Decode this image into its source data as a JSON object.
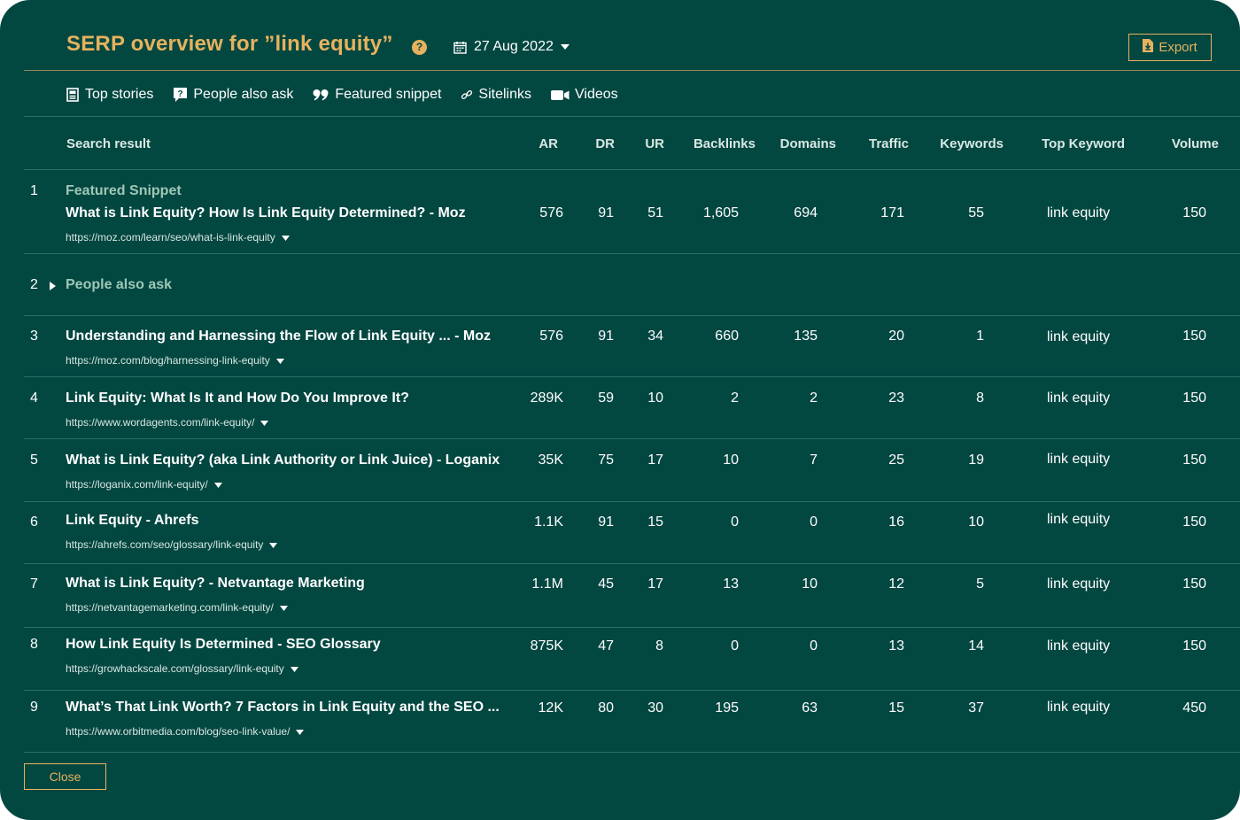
{
  "header": {
    "title": "SERP overview for ”link equity”",
    "help_icon": "?",
    "date": "27 Aug 2022",
    "export_label": "Export"
  },
  "features": [
    {
      "icon": "newspaper-icon",
      "label": "Top stories"
    },
    {
      "icon": "question-bubble-icon",
      "label": "People also ask"
    },
    {
      "icon": "quote-icon",
      "label": "Featured snippet"
    },
    {
      "icon": "link-icon",
      "label": "Sitelinks"
    },
    {
      "icon": "video-camera-icon",
      "label": "Videos"
    }
  ],
  "columns": {
    "search_result": "Search result",
    "ar": "AR",
    "dr": "DR",
    "ur": "UR",
    "backlinks": "Backlinks",
    "domains": "Domains",
    "traffic": "Traffic",
    "keywords": "Keywords",
    "top_keyword": "Top Keyword",
    "volume": "Volume"
  },
  "rows": [
    {
      "num": "1",
      "feature_label": "Featured Snippet",
      "title": "What is Link Equity? How Is Link Equity Determined? - Moz",
      "url": "https://moz.com/learn/seo/what-is-link-equity",
      "ar": "576",
      "dr": "91",
      "ur": "51",
      "backlinks": "1,605",
      "domains": "694",
      "traffic": "171",
      "keywords": "55",
      "top_keyword": "link equity",
      "volume": "150"
    },
    {
      "num": "2",
      "paa_label": "People also ask"
    },
    {
      "num": "3",
      "title": "Understanding and Harnessing the Flow of Link Equity ... - Moz",
      "url": "https://moz.com/blog/harnessing-link-equity",
      "ar": "576",
      "dr": "91",
      "ur": "34",
      "backlinks": "660",
      "domains": "135",
      "traffic": "20",
      "keywords": "1",
      "top_keyword": "link equity",
      "volume": "150"
    },
    {
      "num": "4",
      "title": "Link Equity: What Is It and How Do You Improve It?",
      "url": "https://www.wordagents.com/link-equity/",
      "ar": "289K",
      "dr": "59",
      "ur": "10",
      "backlinks": "2",
      "domains": "2",
      "traffic": "23",
      "keywords": "8",
      "top_keyword": "link equity",
      "volume": "150"
    },
    {
      "num": "5",
      "title": "What is Link Equity? (aka Link Authority or Link Juice) - Loganix",
      "url": "https://loganix.com/link-equity/",
      "ar": "35K",
      "dr": "75",
      "ur": "17",
      "backlinks": "10",
      "domains": "7",
      "traffic": "25",
      "keywords": "19",
      "top_keyword": "link equity",
      "volume": "150"
    },
    {
      "num": "6",
      "title": "Link Equity - Ahrefs",
      "url": "https://ahrefs.com/seo/glossary/link-equity",
      "ar": "1.1K",
      "dr": "91",
      "ur": "15",
      "backlinks": "0",
      "domains": "0",
      "traffic": "16",
      "keywords": "10",
      "top_keyword": "link equity",
      "volume": "150"
    },
    {
      "num": "7",
      "title": "What is Link Equity? - Netvantage Marketing",
      "url": "https://netvantagemarketing.com/link-equity/",
      "ar": "1.1M",
      "dr": "45",
      "ur": "17",
      "backlinks": "13",
      "domains": "10",
      "traffic": "12",
      "keywords": "5",
      "top_keyword": "link equity",
      "volume": "150"
    },
    {
      "num": "8",
      "title": "How Link Equity Is Determined - SEO Glossary",
      "url": "https://growhackscale.com/glossary/link-equity",
      "ar": "875K",
      "dr": "47",
      "ur": "8",
      "backlinks": "0",
      "domains": "0",
      "traffic": "13",
      "keywords": "14",
      "top_keyword": "link equity",
      "volume": "150"
    },
    {
      "num": "9",
      "title": "What’s That Link Worth? 7 Factors in Link Equity and the SEO ...",
      "url": "https://www.orbitmedia.com/blog/seo-link-value/",
      "ar": "12K",
      "dr": "80",
      "ur": "30",
      "backlinks": "195",
      "domains": "63",
      "traffic": "15",
      "keywords": "37",
      "top_keyword": "link equity",
      "volume": "450"
    }
  ],
  "footer": {
    "close_label": "Close"
  }
}
